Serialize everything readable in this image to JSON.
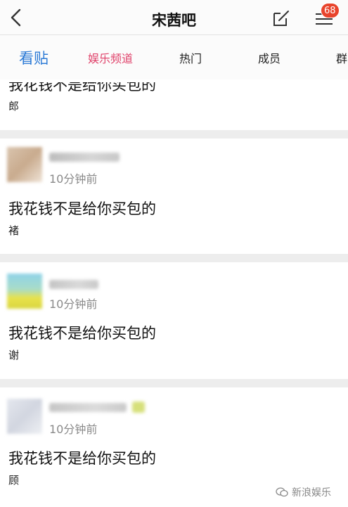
{
  "header": {
    "title": "宋茜吧",
    "notification_count": "68"
  },
  "tabs": [
    {
      "label": "看贴",
      "active": true
    },
    {
      "label": "娱乐频道"
    },
    {
      "label": "热门"
    },
    {
      "label": "成员"
    },
    {
      "label": "群"
    }
  ],
  "posts": [
    {
      "text": "我花钱不是给你买包的",
      "author_sign": "郎"
    },
    {
      "time": "10分钟前",
      "text": "我花钱不是给你买包的",
      "author_sign": "褚"
    },
    {
      "time": "10分钟前",
      "text": "我花钱不是给你买包的",
      "author_sign": "谢"
    },
    {
      "time": "10分钟前",
      "text": "我花钱不是给你买包的",
      "author_sign": "顾"
    }
  ],
  "watermark": {
    "label": "新浪娱乐"
  },
  "colors": {
    "accent_blue": "#2b7ad6",
    "accent_pink": "#e0436b",
    "badge_red": "#e8442c"
  }
}
